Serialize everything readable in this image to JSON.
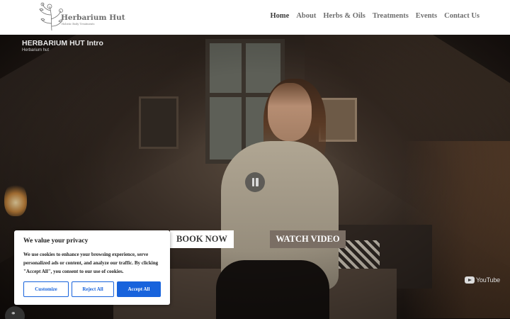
{
  "header": {
    "logo": {
      "title": "Herbarium Hut",
      "subtitle": "Holistic Body Treatments",
      "icon": "botanical-logo-icon"
    },
    "nav": [
      {
        "label": "Home",
        "active": true
      },
      {
        "label": "About",
        "active": false
      },
      {
        "label": "Herbs & Oils",
        "active": false
      },
      {
        "label": "Treatments",
        "active": false
      },
      {
        "label": "Events",
        "active": false
      },
      {
        "label": "Contact Us",
        "active": false
      }
    ]
  },
  "video": {
    "title": "HERBARIUM HUT Intro",
    "channel": "Herbarium hut",
    "state": "playing",
    "pause_icon": "pause-icon",
    "youtube_label": "YouTube",
    "link_icon": "link-icon"
  },
  "hero_buttons": {
    "book": "BOOK NOW",
    "watch": "WATCH VIDEO"
  },
  "cookie_banner": {
    "title": "We value your privacy",
    "text": "We use cookies to enhance your browsing experience, serve personalized ads or content, and analyze our traffic. By clicking \"Accept All\", you consent to our use of cookies.",
    "customize": "Customize",
    "reject": "Reject All",
    "accept": "Accept All"
  },
  "colors": {
    "accent_blue": "#1863dc",
    "watch_button_bg": "#7a6e64",
    "nav_text": "#6e6e6e"
  }
}
